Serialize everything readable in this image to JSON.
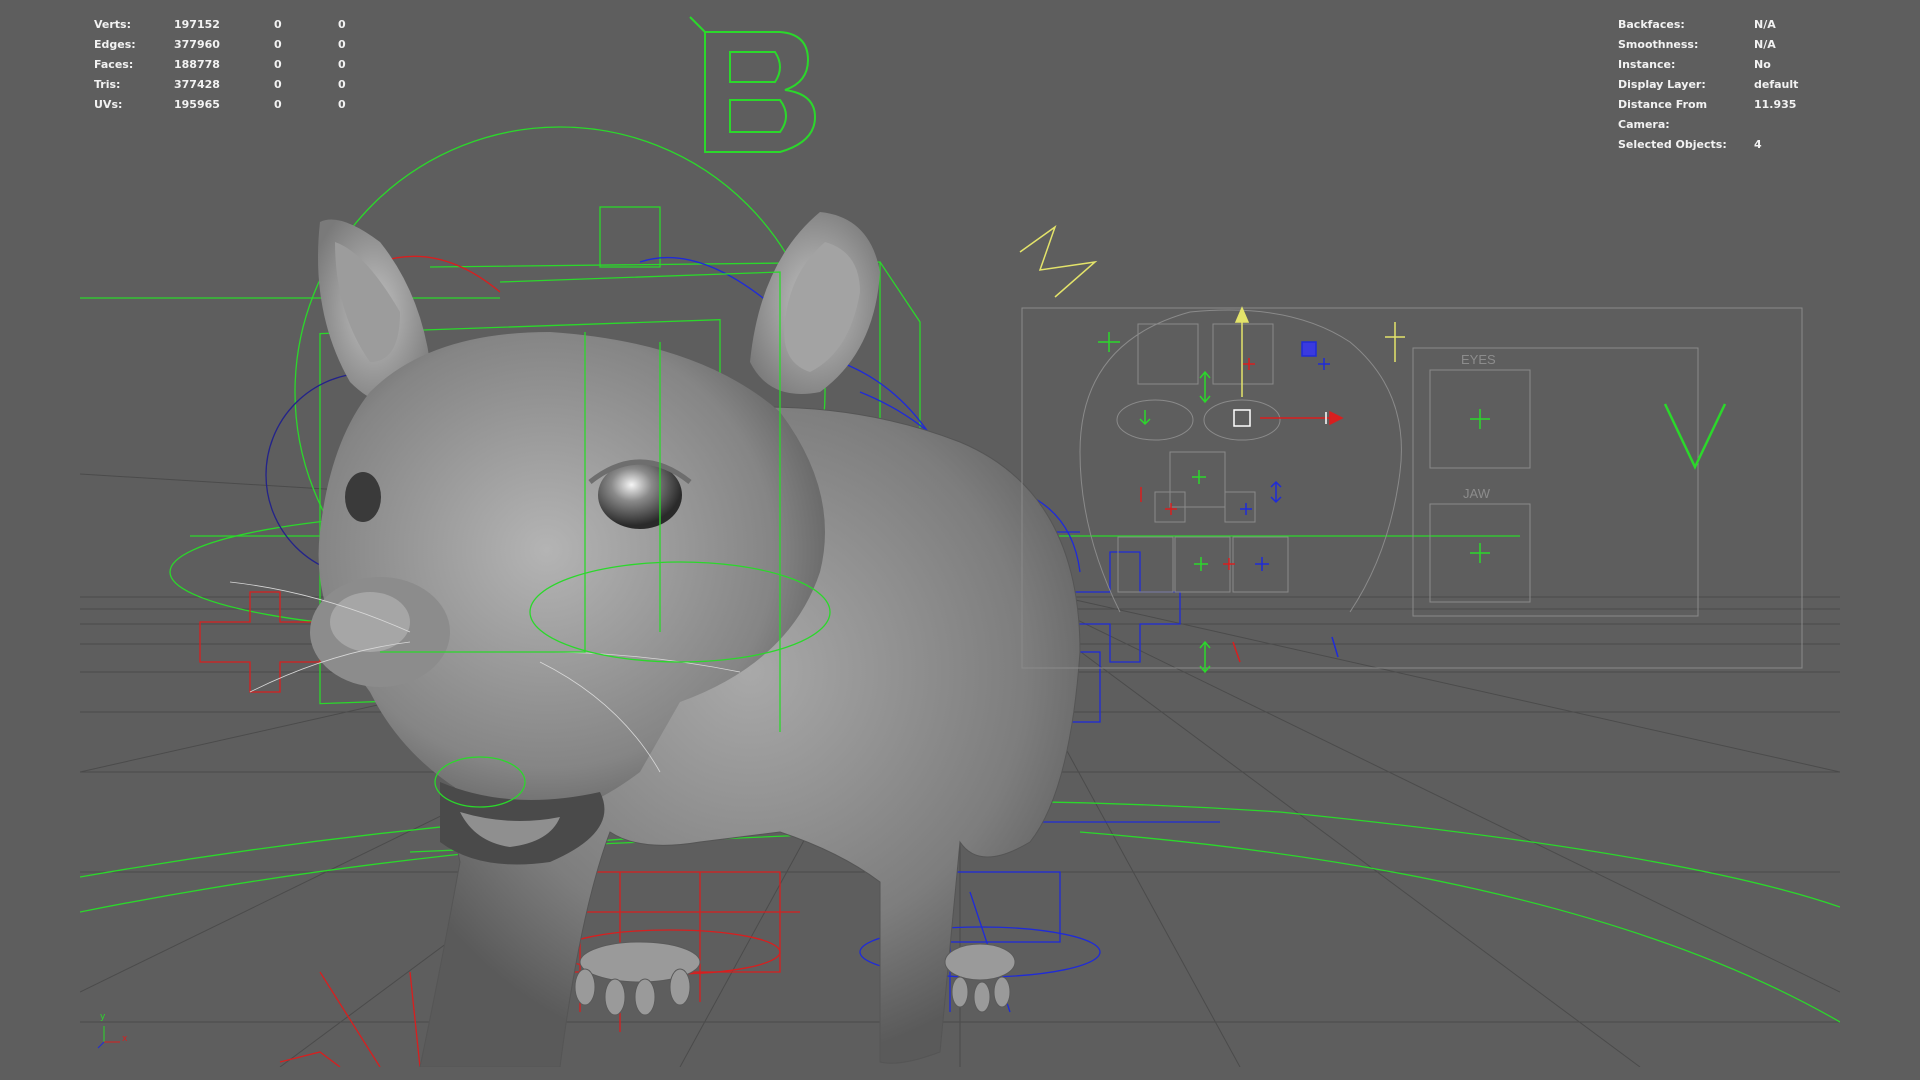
{
  "hud_left": {
    "rows": [
      {
        "label": "Verts:",
        "v1": "197152",
        "v2": "0",
        "v3": "0"
      },
      {
        "label": "Edges:",
        "v1": "377960",
        "v2": "0",
        "v3": "0"
      },
      {
        "label": "Faces:",
        "v1": "188778",
        "v2": "0",
        "v3": "0"
      },
      {
        "label": "Tris:",
        "v1": "377428",
        "v2": "0",
        "v3": "0"
      },
      {
        "label": "UVs:",
        "v1": "195965",
        "v2": "0",
        "v3": "0"
      }
    ]
  },
  "hud_right": {
    "rows": [
      {
        "label": "Backfaces:",
        "value": "N/A"
      },
      {
        "label": "Smoothness:",
        "value": "N/A"
      },
      {
        "label": "Instance:",
        "value": "No"
      },
      {
        "label": "Display Layer:",
        "value": "default"
      },
      {
        "label": "Distance From Camera:",
        "value": "11.935"
      },
      {
        "label": "Selected Objects:",
        "value": "4"
      }
    ]
  },
  "face_panel": {
    "eyes_label": "EYES",
    "jaw_label": "JAW",
    "v_letter": "V",
    "b_letter": "B"
  },
  "axis": {
    "y": "y",
    "x": "x"
  },
  "colors": {
    "background": "#5e5e5e",
    "grid": "#4a4a4a",
    "control_green": "#2bd82b",
    "control_blue": "#1f2bd8",
    "control_red": "#d81f1f",
    "yellow": "#e3e36a",
    "mesh": "#9a9a9a"
  }
}
